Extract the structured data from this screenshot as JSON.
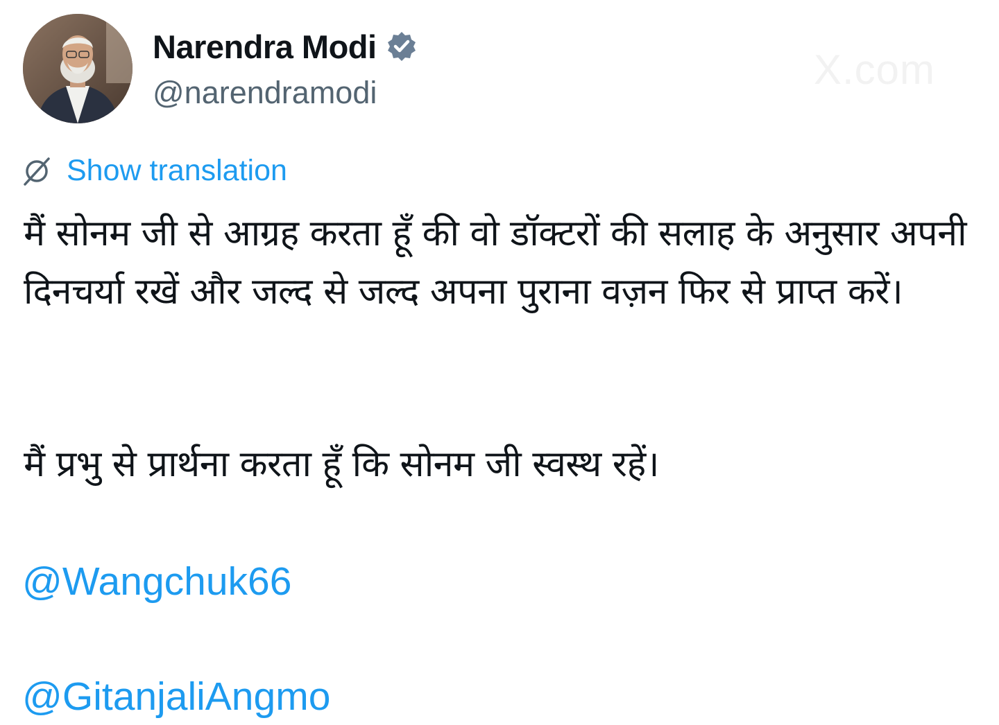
{
  "author": {
    "display_name": "Narendra Modi",
    "handle": "@narendramodi",
    "verified": true
  },
  "watermark": "X.com",
  "translation": {
    "label": "Show translation"
  },
  "tweet": {
    "paragraph1": "मैं सोनम जी से आग्रह करता हूँ की वो डॉक्टरों की सलाह के अनुसार अपनी दिनचर्या रखें और जल्द से जल्द अपना पुराना वज़न फिर से प्राप्त करें।",
    "paragraph2": "मैं प्रभु से प्रार्थना करता हूँ कि सोनम जी स्वस्थ रहें।",
    "mentions": [
      "@Wangchuk66",
      "@GitanjaliAngmo"
    ]
  },
  "icons": {
    "verified": "verified-badge-icon",
    "translate": "globe-translate-icon"
  },
  "colors": {
    "link": "#1d9bf0",
    "text": "#0f1419",
    "secondary": "#536471",
    "verified_badge": "#6b7f95"
  }
}
